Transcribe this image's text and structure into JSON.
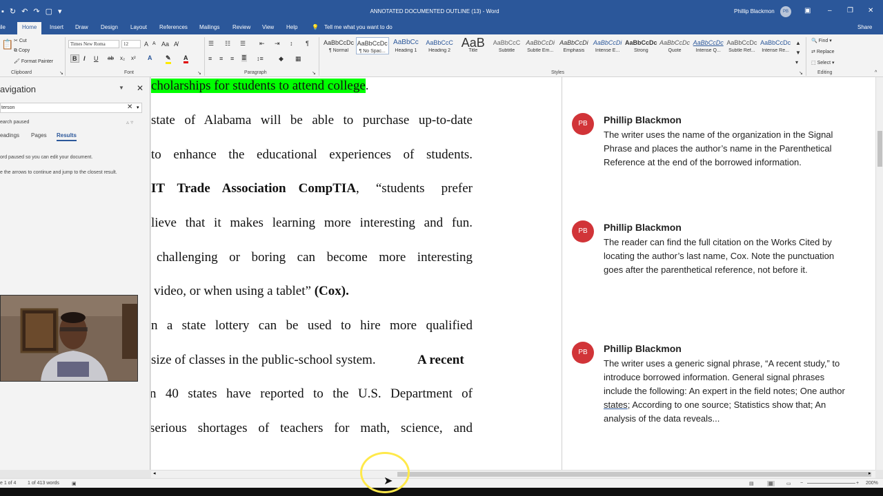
{
  "titlebar": {
    "doc_title": "ANNOTATED DOCUMENTED OUTLINE (13) - Word",
    "user_name": "Phillip Blackmon",
    "user_initials": "PB"
  },
  "tabs": [
    "ile",
    "Home",
    "Insert",
    "Draw",
    "Design",
    "Layout",
    "References",
    "Mailings",
    "Review",
    "View",
    "Help"
  ],
  "tell_me": "Tell me what you want to do",
  "share": "Share",
  "clipboard": {
    "cut": "Cut",
    "copy": "Copy",
    "format_painter": "Format Painter",
    "label": "Clipboard"
  },
  "font": {
    "name": "Times New Roma",
    "size": "12",
    "label": "Font"
  },
  "paragraph": {
    "label": "Paragraph"
  },
  "styles": {
    "label": "Styles",
    "items": [
      {
        "preview": "AaBbCcDc",
        "name": "¶ Normal"
      },
      {
        "preview": "AaBbCcDc",
        "name": "¶ No Spac..."
      },
      {
        "preview": "AaBbCc",
        "name": "Heading 1"
      },
      {
        "preview": "AaBbCcC",
        "name": "Heading 2"
      },
      {
        "preview": "AaB",
        "name": "Title"
      },
      {
        "preview": "AaBbCcC",
        "name": "Subtitle"
      },
      {
        "preview": "AaBbCcDi",
        "name": "Subtle Em..."
      },
      {
        "preview": "AaBbCcDi",
        "name": "Emphasis"
      },
      {
        "preview": "AaBbCcDi",
        "name": "Intense E..."
      },
      {
        "preview": "AaBbCcDc",
        "name": "Strong"
      },
      {
        "preview": "AaBbCcDc",
        "name": "Quote"
      },
      {
        "preview": "AaBbCcDc",
        "name": "Intense Q..."
      },
      {
        "preview": "AaBbCcDc",
        "name": "Subtle Ref..."
      },
      {
        "preview": "AaBbCcDc",
        "name": "Intense Re..."
      }
    ]
  },
  "editing": {
    "find": "Find",
    "replace": "Replace",
    "select": "Select",
    "label": "Editing"
  },
  "navpane": {
    "title": "avigation",
    "search_value": "terson",
    "search_paused": "earch paused",
    "tabs": [
      "eadings",
      "Pages",
      "Results"
    ],
    "msg1": "ord paused so you can edit your document.",
    "msg2": "e the arrows to continue and jump to the closest result."
  },
  "document": {
    "lines": [
      "cholarships for students to attend college",
      "state of Alabama will be able to purchase up-to-date",
      "to enhance the educational experiences of students.",
      "IT Trade Association CompTIA, “students prefer",
      "lieve that it makes learning more interesting and fun.",
      "challenging or boring can become more interesting",
      "video, or when using a tablet” (Cox).",
      "n a state lottery can be used to hire more qualified",
      "size of classes in the public-school system.",
      "A recent",
      "n 40 states have reported to the U.S. Department of",
      "serious shortages of teachers for math, science, and"
    ],
    "line0_period": ".",
    "line3_bold": "IT Trade Association CompTIA",
    "line3_rest": ", “students prefer",
    "line6_plain": "video, or when using a tablet” ",
    "line6_bold": "(Cox)."
  },
  "comments": [
    {
      "initials": "PB",
      "author": "Phillip Blackmon",
      "text": "The writer uses the name of the organization in the Signal Phrase and places the author’s name in the Parenthetical Reference at the end of the borrowed information."
    },
    {
      "initials": "PB",
      "author": "Phillip Blackmon",
      "text": "The reader can find the full citation on the Works Cited by locating the author’s last name, Cox. Note the punctuation goes after the parenthetical reference, not before it."
    },
    {
      "initials": "PB",
      "author": "Phillip Blackmon",
      "text_before": "The writer uses a generic signal phrase, “A recent study,” to introduce borrowed information. General signal phrases include the following: An expert in the field notes; One author ",
      "text_link": "states",
      "text_after": "; According to one source; Statistics show that; An analysis of the data reveals..."
    }
  ],
  "status": {
    "page": "e 1 of 4",
    "words": "1 of 413 words",
    "zoom": "200%"
  },
  "colors": {
    "word_blue": "#2b579a",
    "highlight_green": "#00ff00",
    "comment_avatar": "#d13438"
  }
}
